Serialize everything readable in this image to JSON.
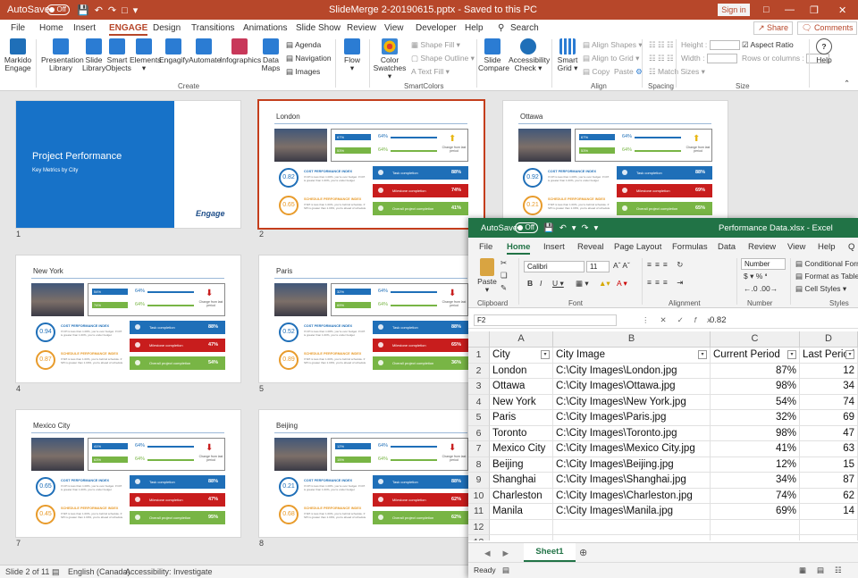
{
  "ppt": {
    "title": {
      "autosave": "AutoSave",
      "toggle": "Off",
      "doc": "SlideMerge 2-20190615.pptx  -  Saved to this PC",
      "signin": "Sign in"
    },
    "tabs": [
      "File",
      "Home",
      "Insert",
      "ENGAGE",
      "Design",
      "Transitions",
      "Animations",
      "Slide Show",
      "Review",
      "View",
      "Developer",
      "Help"
    ],
    "search": "Search",
    "share": "Share",
    "comments": "Comments",
    "ribbon": {
      "markido": "Markido Engage",
      "presentation_library": "Presentation Library",
      "slide_library": "Slide Library",
      "smart_objects": "Smart Objects",
      "elements": "Elements",
      "engagify": "Engagify",
      "automate": "Automate",
      "infographics": "Infographics",
      "data_maps": "Data Maps",
      "agenda": "Agenda",
      "navigation": "Navigation",
      "images": "Images",
      "flow": "Flow",
      "color_swatches": "Color Swatches",
      "shape_fill": "Shape Fill",
      "shape_outline": "Shape Outline",
      "text_fill": "Text Fill",
      "slide_compare": "Slide Compare",
      "accessibility_check": "Accessibility Check",
      "smart_grid": "Smart Grid",
      "align_shapes": "Align Shapes",
      "align_to_grid": "Align to Grid",
      "copy": "Copy",
      "paste": "Paste",
      "match_sizes": "Match Sizes",
      "height": "Height :",
      "width": "Width :",
      "aspect_ratio": "Aspect Ratio",
      "rows_or_columns": "Rows or columns :",
      "help": "Help",
      "groups": {
        "create": "Create",
        "smartcolors": "SmartColors",
        "align": "Align",
        "spacing": "Spacing",
        "size": "Size"
      }
    },
    "slides": [
      {
        "num": "1",
        "title": "Project Performance",
        "subtitle": "Key Metrics by City",
        "logo": "Engage"
      },
      {
        "num": "2",
        "city": "London",
        "p1": "64%",
        "p2": "64%",
        "b1": "67%",
        "b2": "53%",
        "arrow": "up",
        "ci1": "0.82",
        "ci2": "0.65",
        "task": "88%",
        "milestone": "74%",
        "overall": "41%"
      },
      {
        "num": "3",
        "city": "Ottawa",
        "p1": "64%",
        "p2": "64%",
        "b1": "67%",
        "b2": "53%",
        "arrow": "up",
        "ci1": "0.92",
        "ci2": "0.21",
        "task": "88%",
        "milestone": "69%",
        "overall": "65%"
      },
      {
        "num": "4",
        "city": "New York",
        "p1": "64%",
        "p2": "64%",
        "b1": "54%",
        "b2": "74%",
        "arrow": "down",
        "ci1": "0.94",
        "ci2": "0.87",
        "task": "88%",
        "milestone": "47%",
        "overall": "54%"
      },
      {
        "num": "5",
        "city": "Paris",
        "p1": "64%",
        "p2": "64%",
        "b1": "32%",
        "b2": "69%",
        "arrow": "down",
        "ci1": "0.52",
        "ci2": "0.89",
        "task": "88%",
        "milestone": "65%",
        "overall": "36%"
      },
      {
        "num": "7",
        "city": "Mexico City",
        "p1": "64%",
        "p2": "64%",
        "b1": "41%",
        "b2": "63%",
        "arrow": "down",
        "ci1": "0.65",
        "ci2": "0.45",
        "task": "88%",
        "milestone": "47%",
        "overall": "95%"
      },
      {
        "num": "8",
        "city": "Beijing",
        "p1": "64%",
        "p2": "64%",
        "b1": "12%",
        "b2": "15%",
        "arrow": "down",
        "ci1": "0.21",
        "ci2": "0.68",
        "task": "88%",
        "milestone": "62%",
        "overall": "62%"
      }
    ],
    "labels": {
      "change": "Change from last period",
      "cpi": "COST PERFORMANCE INDEX",
      "spi": "SCHEDULE PERFORMANCE INDEX",
      "cpi_desc": "If CPI is less than 1.00%, you're over budget. If CPI is greater than 1.00%, you're under budget",
      "spi_desc": "If SPI is less than 1.00%, you're behind schedule. If SPI is greater than 1.00%, you're ahead of schedule",
      "task": "Task completion",
      "milestone": "Milestone completion",
      "overall": "Overall project completion"
    },
    "status": {
      "slide": "Slide 2 of 11",
      "lang": "English (Canada)",
      "access": "Accessibility: Investigate"
    }
  },
  "excel": {
    "title": {
      "autosave": "AutoSave",
      "toggle": "Off",
      "doc": "Performance Data.xlsx  -  Excel"
    },
    "tabs": [
      "File",
      "Home",
      "Insert",
      "Reveal",
      "Page Layout",
      "Formulas",
      "Data",
      "Review",
      "View",
      "Help",
      "Q"
    ],
    "ribbon": {
      "paste": "Paste",
      "clipboard": "Clipboard",
      "font_name": "Calibri",
      "font_size": "11",
      "font": "Font",
      "alignment": "Alignment",
      "number_format": "Number",
      "number": "Number",
      "conditional": "Conditional Format",
      "format_table": "Format as Table",
      "cell_styles": "Cell Styles",
      "styles": "Styles"
    },
    "namebox": "F2",
    "formula": "0.82",
    "columns": [
      "A",
      "B",
      "C",
      "D"
    ],
    "headers": [
      "City",
      "City Image",
      "Current Period",
      "Last Period"
    ],
    "rows": [
      [
        "London",
        "C:\\City Images\\London.jpg",
        "87%",
        "12"
      ],
      [
        "Ottawa",
        "C:\\City Images\\Ottawa.jpg",
        "98%",
        "34"
      ],
      [
        "New York",
        "C:\\City Images\\New York.jpg",
        "54%",
        "74"
      ],
      [
        "Paris",
        "C:\\City Images\\Paris.jpg",
        "32%",
        "69"
      ],
      [
        "Toronto",
        "C:\\City Images\\Toronto.jpg",
        "98%",
        "47"
      ],
      [
        "Mexico City",
        "C:\\City Images\\Mexico City.jpg",
        "41%",
        "63"
      ],
      [
        "Beijing",
        "C:\\City Images\\Beijing.jpg",
        "12%",
        "15"
      ],
      [
        "Shanghai",
        "C:\\City Images\\Shanghai.jpg",
        "34%",
        "87"
      ],
      [
        "Charleston",
        "C:\\City Images\\Charleston.jpg",
        "74%",
        "62"
      ],
      [
        "Manila",
        "C:\\City Images\\Manila.jpg",
        "69%",
        "14"
      ]
    ],
    "row_numbers": [
      "1",
      "2",
      "3",
      "4",
      "5",
      "6",
      "7",
      "8",
      "9",
      "10",
      "11",
      "12",
      "13"
    ],
    "sheet": "Sheet1",
    "status": "Ready"
  }
}
